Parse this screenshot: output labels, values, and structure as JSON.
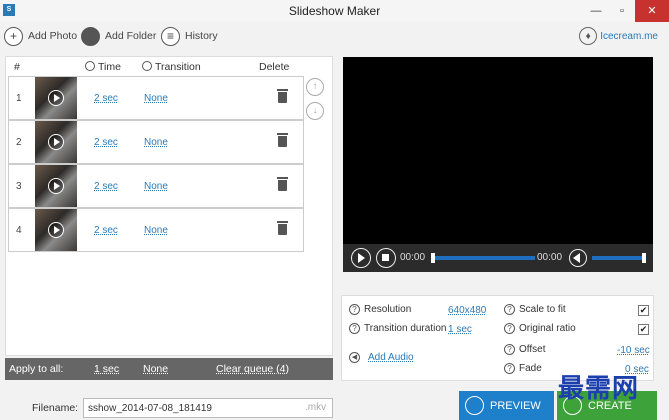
{
  "window": {
    "title": "Slideshow Maker",
    "minimize": "—",
    "restore": "▫",
    "close": "✕"
  },
  "toolbar": {
    "add_photo": "Add Photo",
    "add_folder": "Add Folder",
    "history": "History",
    "brand": "Icecream.me",
    "icons": {
      "add_photo": "plus-icon",
      "add_folder": "folder-icon",
      "history": "list-icon"
    }
  },
  "list": {
    "headers": {
      "num": "#",
      "time": "Time",
      "transition": "Transition",
      "delete": "Delete"
    },
    "rows": [
      {
        "num": "1",
        "time": "2 sec",
        "transition": "None"
      },
      {
        "num": "2",
        "time": "2 sec",
        "transition": "None"
      },
      {
        "num": "3",
        "time": "2 sec",
        "transition": "None"
      },
      {
        "num": "4",
        "time": "2 sec",
        "transition": "None"
      }
    ],
    "move_up": "↑",
    "move_down": "↓"
  },
  "apply_all": {
    "label": "Apply to all:",
    "time": "1 sec",
    "transition": "None",
    "clear": "Clear queue (4)"
  },
  "filename": {
    "label": "Filename:",
    "value": "sshow_2014-07-08_181419",
    "ext": ".mkv"
  },
  "player": {
    "current": "00:00",
    "total": "00:00"
  },
  "settings": {
    "resolution": {
      "label": "Resolution",
      "value": "640x480"
    },
    "transition_duration": {
      "label": "Transition duration",
      "value": "1 sec"
    },
    "add_audio": "Add Audio",
    "scale_to_fit": {
      "label": "Scale to fit",
      "check": "✔"
    },
    "original_ratio": {
      "label": "Original ratio",
      "check": "✔"
    },
    "offset": {
      "label": "Offset",
      "value": "-10 sec"
    },
    "fade": {
      "label": "Fade",
      "value": "0 sec"
    }
  },
  "buttons": {
    "preview": "PREVIEW",
    "create": "CREATE"
  },
  "watermark": "最需网",
  "colors": {
    "accent": "#2a7ab8",
    "preview": "#1e7fcb",
    "create": "#3ea23a",
    "close": "#c7322f"
  }
}
